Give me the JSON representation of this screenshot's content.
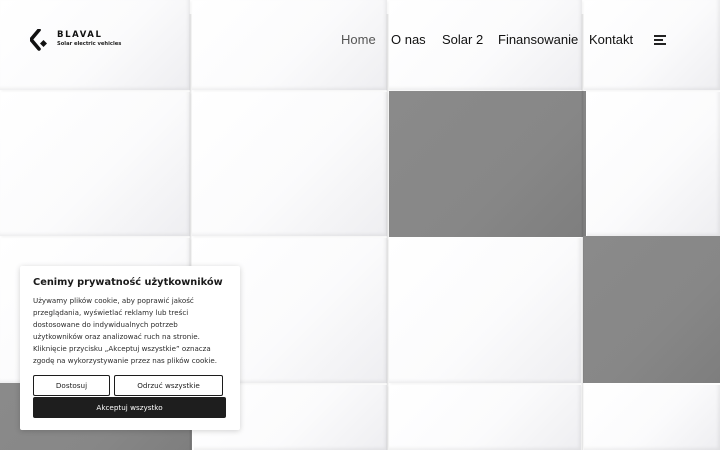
{
  "brand": {
    "name": "BLAVAL",
    "tagline": "Solar electric vehicles"
  },
  "nav": {
    "items": [
      {
        "label": "Home",
        "active": true
      },
      {
        "label": "O nas",
        "active": false
      },
      {
        "label": "Solar 2",
        "active": false
      },
      {
        "label": "Finansowanie",
        "active": false
      },
      {
        "label": "Kontakt",
        "active": false
      }
    ],
    "menu_icon": "hamburger-icon"
  },
  "cookie_banner": {
    "title": "Cenimy prywatność użytkowników",
    "body": "Używamy plików cookie, aby poprawić jakość przeglądania, wyświetlać reklamy lub treści dostosowane do indywidualnych potrzeb użytkowników oraz analizować ruch na stronie. Kliknięcie przycisku „Akceptuj wszystkie” oznacza zgodę na wykorzystywanie przez nas plików cookie.",
    "customize_label": "Dostosuj",
    "reject_label": "Odrzuć wszystkie",
    "accept_label": "Akceptuj wszystko"
  },
  "colors": {
    "tile_gray": "#888888",
    "button_dark": "#1e1e1e",
    "text_dark": "#111111"
  }
}
